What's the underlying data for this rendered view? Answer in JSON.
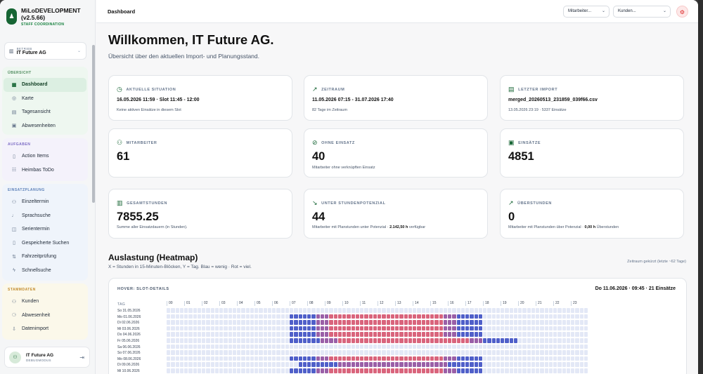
{
  "app": {
    "name": "MiLoDEVELOPMENT (v2.5.66)",
    "subtitle": "STAFF COORDINATION"
  },
  "betrieb": {
    "label": "BETRIEB",
    "value": "IT Future AG"
  },
  "sections": [
    {
      "title": "ÜBERSICHT",
      "color": "#4d8a5c",
      "items": [
        {
          "label": "Dashboard",
          "icon": "▦",
          "active": true
        },
        {
          "label": "Karte",
          "icon": "◎"
        },
        {
          "label": "Tagesansicht",
          "icon": "▤"
        },
        {
          "label": "Abwesenheiten",
          "icon": "▣"
        }
      ]
    },
    {
      "title": "AUFGABEN",
      "color": "#7b6bc4",
      "items": [
        {
          "label": "Action Items",
          "icon": "▯"
        },
        {
          "label": "Heimbas ToDo",
          "icon": "☷"
        }
      ]
    },
    {
      "title": "EINSATZPLANUNG",
      "color": "#5b7fb8",
      "items": [
        {
          "label": "Einzeltermin",
          "icon": "⚇"
        },
        {
          "label": "Sprachsuche",
          "icon": "♩"
        },
        {
          "label": "Serientermin",
          "icon": "◫"
        },
        {
          "label": "Gespeicherte Suchen",
          "icon": "▯"
        },
        {
          "label": "Fahrzeitprüfung",
          "icon": "⇅"
        },
        {
          "label": "Schnellsuche",
          "icon": "ϟ"
        }
      ]
    },
    {
      "title": "STAMMDATEN",
      "color": "#c28a2a",
      "items": [
        {
          "label": "Kunden",
          "icon": "⚇"
        },
        {
          "label": "Abwesenheit",
          "icon": "⚆"
        },
        {
          "label": "Datenimport",
          "icon": "⇩"
        }
      ]
    }
  ],
  "user": {
    "name": "IT Future AG",
    "mode": "DEBUGMODUS"
  },
  "topbar": {
    "crumb": "Dashboard",
    "dd1": "Mitarbeiter...",
    "dd2": "Kunden..."
  },
  "page": {
    "title": "Willkommen, IT Future AG.",
    "subtitle": "Übersicht über den aktuellen Import- und Planungsstand."
  },
  "cards": [
    {
      "label": "AKTUELLE SITUATION",
      "icon": "◷",
      "mid": "16.05.2026 11:59 · Slot 11:45 - 12:00",
      "note": "Keine aktiven Einsätze in diesem Slot"
    },
    {
      "label": "ZEITRAUM",
      "icon": "↗",
      "mid": "11.05.2026 07:15 - 31.07.2026 17:40",
      "note": "82 Tage im Zeitraum"
    },
    {
      "label": "LETZTER IMPORT",
      "icon": "▤",
      "mid": "merged_20260513_231859_039f66.csv",
      "note": "13.05.2026 23:19 · 5337 Einsätze"
    },
    {
      "label": "MITARBEITER",
      "icon": "⚇",
      "big": "61",
      "note": ""
    },
    {
      "label": "OHNE EINSATZ",
      "icon": "⊘",
      "big": "40",
      "note": "Mitarbeiter ohne verknüpften Einsatz"
    },
    {
      "label": "EINSÄTZE",
      "icon": "▣",
      "big": "4851",
      "note": ""
    },
    {
      "label": "GESAMTSTUNDEN",
      "icon": "▥",
      "big": "7855.25",
      "note": "Summe aller Einsatzdauern (in Stunden)."
    },
    {
      "label": "UNTER STUNDENPOTENZIAL",
      "icon": "↘",
      "big": "44",
      "note_pre": "Mitarbeiter mit Planstunden unter Potenzial · ",
      "note_bold": "2.142,50 h",
      "note_post": " verfügbar"
    },
    {
      "label": "ÜBERSTUNDEN",
      "icon": "↗",
      "big": "0",
      "note_pre": "Mitarbeiter mit Planstunden über Potenzial · ",
      "note_bold": "0,00 h",
      "note_post": " Überstunden"
    }
  ],
  "heatmap": {
    "title": "Auslastung (Heatmap)",
    "subtitle": "X = Stunden in 15-Minuten-Blöcken, Y = Tag. Blau = wenig · Rot = viel.",
    "range_note": "Zeitraum gekürzt (letzte ~62 Tage)",
    "hover_label": "HOVER: SLOT-DETAILS",
    "hover_value": "Do 11.06.2026 · 09:45 · 21 Einsätze",
    "tag_label": "TAG",
    "hours": [
      "00",
      "01",
      "02",
      "03",
      "04",
      "05",
      "06",
      "07",
      "08",
      "09",
      "10",
      "11",
      "12",
      "13",
      "14",
      "15",
      "16",
      "17",
      "18",
      "19",
      "20",
      "21",
      "22",
      "23"
    ],
    "days": [
      "So 31.05.2026",
      "Mo 01.06.2026",
      "Di 02.06.2026",
      "Mi 03.06.2026",
      "Do 04.06.2026",
      "Fr 05.06.2026",
      "Sa 06.06.2026",
      "So 07.06.2026",
      "Mo 08.06.2026",
      "Di 09.06.2026",
      "Mi 10.06.2026"
    ],
    "active_ranges": [
      [
        0,
        0
      ],
      [
        28,
        72
      ],
      [
        28,
        72
      ],
      [
        28,
        72
      ],
      [
        28,
        72
      ],
      [
        28,
        80
      ],
      [
        0,
        0
      ],
      [
        0,
        0
      ],
      [
        28,
        72
      ],
      [
        30,
        72
      ],
      [
        28,
        72
      ]
    ],
    "colors": {
      "empty": "#e3e8f6",
      "low": "#4f5fc9",
      "high": "#d9647c",
      "mid": "#9a5fa7"
    }
  }
}
